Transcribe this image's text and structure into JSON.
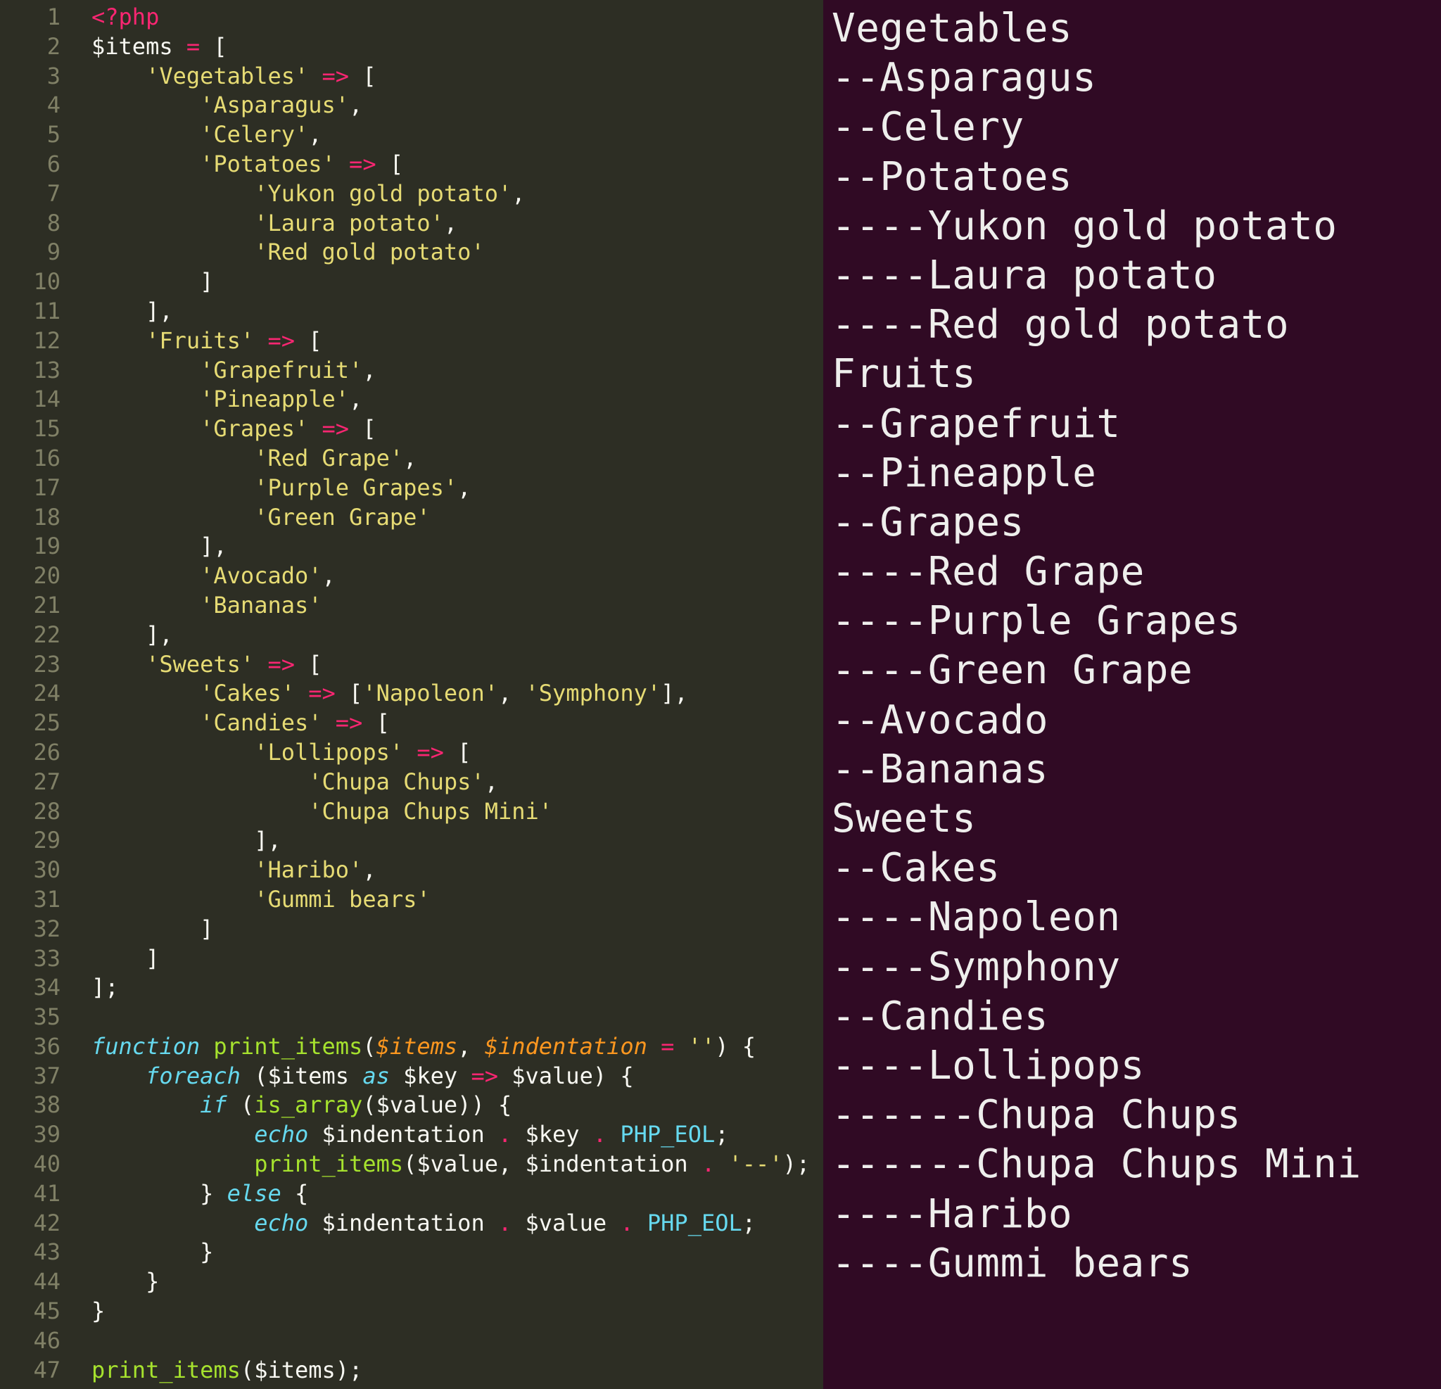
{
  "editor": {
    "line_count": 47,
    "tokens": [
      [
        [
          "tag",
          "<?php"
        ]
      ],
      [
        [
          "var",
          "$items"
        ],
        [
          "pun",
          " "
        ],
        [
          "op",
          "="
        ],
        [
          "pun",
          " ["
        ]
      ],
      [
        [
          "pun",
          "    "
        ],
        [
          "str",
          "'Vegetables'"
        ],
        [
          "pun",
          " "
        ],
        [
          "op",
          "=>"
        ],
        [
          "pun",
          " ["
        ]
      ],
      [
        [
          "pun",
          "        "
        ],
        [
          "str",
          "'Asparagus'"
        ],
        [
          "pun",
          ","
        ]
      ],
      [
        [
          "pun",
          "        "
        ],
        [
          "str",
          "'Celery'"
        ],
        [
          "pun",
          ","
        ]
      ],
      [
        [
          "pun",
          "        "
        ],
        [
          "str",
          "'Potatoes'"
        ],
        [
          "pun",
          " "
        ],
        [
          "op",
          "=>"
        ],
        [
          "pun",
          " ["
        ]
      ],
      [
        [
          "pun",
          "            "
        ],
        [
          "str",
          "'Yukon gold potato'"
        ],
        [
          "pun",
          ","
        ]
      ],
      [
        [
          "pun",
          "            "
        ],
        [
          "str",
          "'Laura potato'"
        ],
        [
          "pun",
          ","
        ]
      ],
      [
        [
          "pun",
          "            "
        ],
        [
          "str",
          "'Red gold potato'"
        ]
      ],
      [
        [
          "pun",
          "        ]"
        ]
      ],
      [
        [
          "pun",
          "    ],"
        ]
      ],
      [
        [
          "pun",
          "    "
        ],
        [
          "str",
          "'Fruits'"
        ],
        [
          "pun",
          " "
        ],
        [
          "op",
          "=>"
        ],
        [
          "pun",
          " ["
        ]
      ],
      [
        [
          "pun",
          "        "
        ],
        [
          "str",
          "'Grapefruit'"
        ],
        [
          "pun",
          ","
        ]
      ],
      [
        [
          "pun",
          "        "
        ],
        [
          "str",
          "'Pineapple'"
        ],
        [
          "pun",
          ","
        ]
      ],
      [
        [
          "pun",
          "        "
        ],
        [
          "str",
          "'Grapes'"
        ],
        [
          "pun",
          " "
        ],
        [
          "op",
          "=>"
        ],
        [
          "pun",
          " ["
        ]
      ],
      [
        [
          "pun",
          "            "
        ],
        [
          "str",
          "'Red Grape'"
        ],
        [
          "pun",
          ","
        ]
      ],
      [
        [
          "pun",
          "            "
        ],
        [
          "str",
          "'Purple Grapes'"
        ],
        [
          "pun",
          ","
        ]
      ],
      [
        [
          "pun",
          "            "
        ],
        [
          "str",
          "'Green Grape'"
        ]
      ],
      [
        [
          "pun",
          "        ],"
        ]
      ],
      [
        [
          "pun",
          "        "
        ],
        [
          "str",
          "'Avocado'"
        ],
        [
          "pun",
          ","
        ]
      ],
      [
        [
          "pun",
          "        "
        ],
        [
          "str",
          "'Bananas'"
        ]
      ],
      [
        [
          "pun",
          "    ],"
        ]
      ],
      [
        [
          "pun",
          "    "
        ],
        [
          "str",
          "'Sweets'"
        ],
        [
          "pun",
          " "
        ],
        [
          "op",
          "=>"
        ],
        [
          "pun",
          " ["
        ]
      ],
      [
        [
          "pun",
          "        "
        ],
        [
          "str",
          "'Cakes'"
        ],
        [
          "pun",
          " "
        ],
        [
          "op",
          "=>"
        ],
        [
          "pun",
          " ["
        ],
        [
          "str",
          "'Napoleon'"
        ],
        [
          "pun",
          ", "
        ],
        [
          "str",
          "'Symphony'"
        ],
        [
          "pun",
          "],"
        ]
      ],
      [
        [
          "pun",
          "        "
        ],
        [
          "str",
          "'Candies'"
        ],
        [
          "pun",
          " "
        ],
        [
          "op",
          "=>"
        ],
        [
          "pun",
          " ["
        ]
      ],
      [
        [
          "pun",
          "            "
        ],
        [
          "str",
          "'Lollipops'"
        ],
        [
          "pun",
          " "
        ],
        [
          "op",
          "=>"
        ],
        [
          "pun",
          " ["
        ]
      ],
      [
        [
          "pun",
          "                "
        ],
        [
          "str",
          "'Chupa Chups'"
        ],
        [
          "pun",
          ","
        ]
      ],
      [
        [
          "pun",
          "                "
        ],
        [
          "str",
          "'Chupa Chups Mini'"
        ]
      ],
      [
        [
          "pun",
          "            ],"
        ]
      ],
      [
        [
          "pun",
          "            "
        ],
        [
          "str",
          "'Haribo'"
        ],
        [
          "pun",
          ","
        ]
      ],
      [
        [
          "pun",
          "            "
        ],
        [
          "str",
          "'Gummi bears'"
        ]
      ],
      [
        [
          "pun",
          "        ]"
        ]
      ],
      [
        [
          "pun",
          "    ]"
        ]
      ],
      [
        [
          "pun",
          "];"
        ]
      ],
      [],
      [
        [
          "kw",
          "function"
        ],
        [
          "pun",
          " "
        ],
        [
          "fn",
          "print_items"
        ],
        [
          "pun",
          "("
        ],
        [
          "arg",
          "$items"
        ],
        [
          "pun",
          ", "
        ],
        [
          "arg",
          "$indentation"
        ],
        [
          "pun",
          " "
        ],
        [
          "op",
          "="
        ],
        [
          "pun",
          " "
        ],
        [
          "str",
          "''"
        ],
        [
          "pun",
          ") {"
        ]
      ],
      [
        [
          "pun",
          "    "
        ],
        [
          "kw",
          "foreach"
        ],
        [
          "pun",
          " ("
        ],
        [
          "var",
          "$items"
        ],
        [
          "pun",
          " "
        ],
        [
          "kw",
          "as"
        ],
        [
          "pun",
          " "
        ],
        [
          "var",
          "$key"
        ],
        [
          "pun",
          " "
        ],
        [
          "op",
          "=>"
        ],
        [
          "pun",
          " "
        ],
        [
          "var",
          "$value"
        ],
        [
          "pun",
          ") {"
        ]
      ],
      [
        [
          "pun",
          "        "
        ],
        [
          "kw",
          "if"
        ],
        [
          "pun",
          " ("
        ],
        [
          "fn",
          "is_array"
        ],
        [
          "pun",
          "("
        ],
        [
          "var",
          "$value"
        ],
        [
          "pun",
          ")) {"
        ]
      ],
      [
        [
          "pun",
          "            "
        ],
        [
          "kw",
          "echo"
        ],
        [
          "pun",
          " "
        ],
        [
          "var",
          "$indentation"
        ],
        [
          "pun",
          " "
        ],
        [
          "op",
          "."
        ],
        [
          "pun",
          " "
        ],
        [
          "var",
          "$key"
        ],
        [
          "pun",
          " "
        ],
        [
          "op",
          "."
        ],
        [
          "pun",
          " "
        ],
        [
          "const",
          "PHP_EOL"
        ],
        [
          "pun",
          ";"
        ]
      ],
      [
        [
          "pun",
          "            "
        ],
        [
          "fn",
          "print_items"
        ],
        [
          "pun",
          "("
        ],
        [
          "var",
          "$value"
        ],
        [
          "pun",
          ", "
        ],
        [
          "var",
          "$indentation"
        ],
        [
          "pun",
          " "
        ],
        [
          "op",
          "."
        ],
        [
          "pun",
          " "
        ],
        [
          "str",
          "'--'"
        ],
        [
          "pun",
          ");"
        ]
      ],
      [
        [
          "pun",
          "        } "
        ],
        [
          "kw",
          "else"
        ],
        [
          "pun",
          " {"
        ]
      ],
      [
        [
          "pun",
          "            "
        ],
        [
          "kw",
          "echo"
        ],
        [
          "pun",
          " "
        ],
        [
          "var",
          "$indentation"
        ],
        [
          "pun",
          " "
        ],
        [
          "op",
          "."
        ],
        [
          "pun",
          " "
        ],
        [
          "var",
          "$value"
        ],
        [
          "pun",
          " "
        ],
        [
          "op",
          "."
        ],
        [
          "pun",
          " "
        ],
        [
          "const",
          "PHP_EOL"
        ],
        [
          "pun",
          ";"
        ]
      ],
      [
        [
          "pun",
          "        }"
        ]
      ],
      [
        [
          "pun",
          "    }"
        ]
      ],
      [
        [
          "pun",
          "}"
        ]
      ],
      [],
      [
        [
          "fn",
          "print_items"
        ],
        [
          "pun",
          "("
        ],
        [
          "var",
          "$items"
        ],
        [
          "pun",
          ");"
        ]
      ]
    ]
  },
  "terminal": {
    "lines": [
      "Vegetables",
      "--Asparagus",
      "--Celery",
      "--Potatoes",
      "----Yukon gold potato",
      "----Laura potato",
      "----Red gold potato",
      "Fruits",
      "--Grapefruit",
      "--Pineapple",
      "--Grapes",
      "----Red Grape",
      "----Purple Grapes",
      "----Green Grape",
      "--Avocado",
      "--Bananas",
      "Sweets",
      "--Cakes",
      "----Napoleon",
      "----Symphony",
      "--Candies",
      "----Lollipops",
      "------Chupa Chups",
      "------Chupa Chups Mini",
      "----Haribo",
      "----Gummi bears"
    ]
  }
}
